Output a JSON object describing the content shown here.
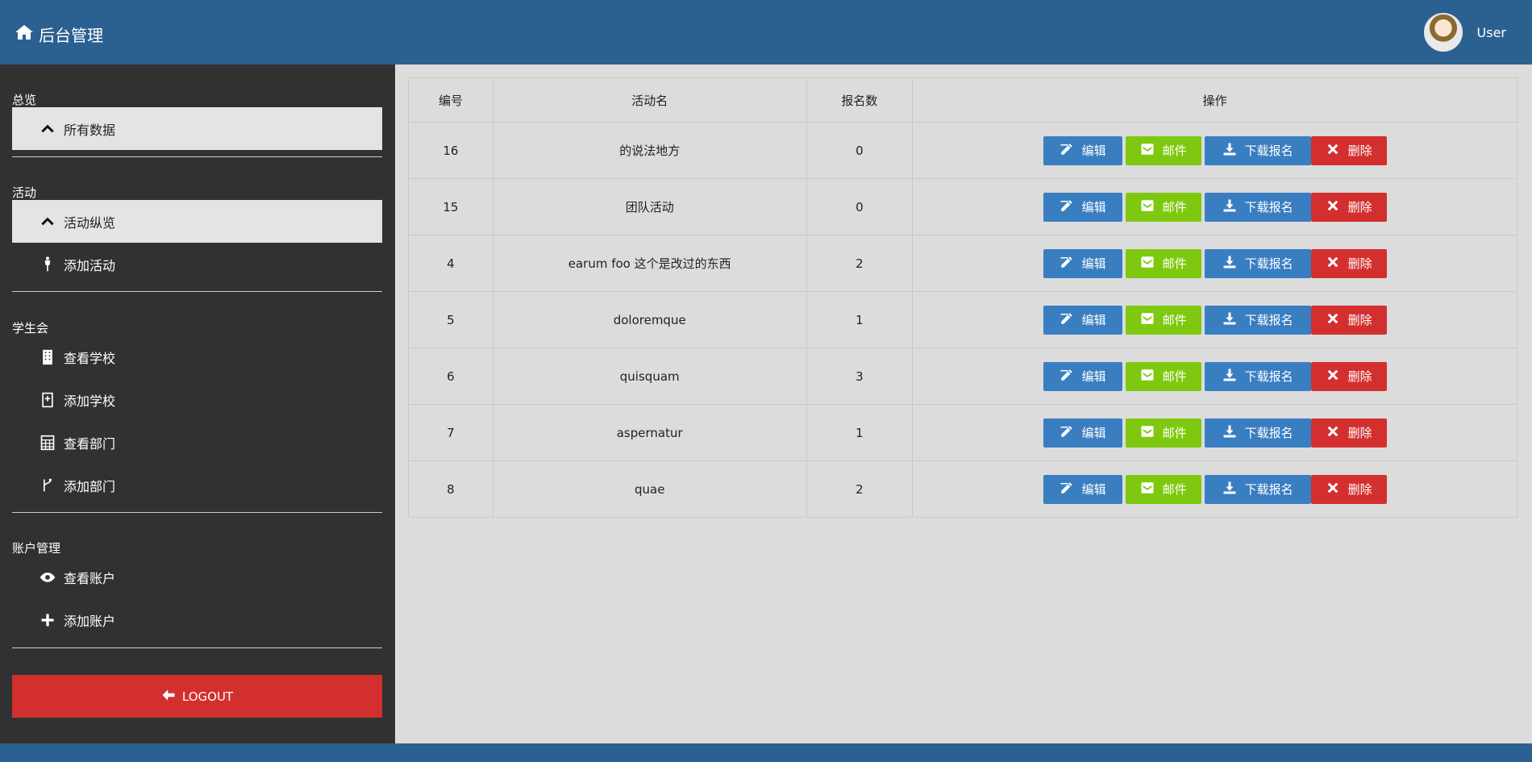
{
  "header": {
    "title": "后台管理",
    "user": "User"
  },
  "sidebar": {
    "sections": [
      {
        "title": "总览",
        "items": [
          {
            "label": "所有数据",
            "icon": "chevron-up-icon",
            "active": true
          }
        ]
      },
      {
        "title": "活动",
        "items": [
          {
            "label": "活动纵览",
            "icon": "chevron-up-icon",
            "active": true
          },
          {
            "label": "添加活动",
            "icon": "person-icon",
            "active": false
          }
        ]
      },
      {
        "title": "学生会",
        "items": [
          {
            "label": "查看学校",
            "icon": "building-icon",
            "active": false
          },
          {
            "label": "添加学校",
            "icon": "building-plus-icon",
            "active": false
          },
          {
            "label": "查看部门",
            "icon": "calculator-icon",
            "active": false
          },
          {
            "label": "添加部门",
            "icon": "branch-icon",
            "active": false
          }
        ]
      },
      {
        "title": "账户管理",
        "items": [
          {
            "label": "查看账户",
            "icon": "eye-icon",
            "active": false
          },
          {
            "label": "添加账户",
            "icon": "plus-icon",
            "active": false
          }
        ]
      }
    ],
    "logout_label": "LOGOUT"
  },
  "table": {
    "headers": [
      "编号",
      "活动名",
      "报名数",
      "操作"
    ],
    "rows": [
      {
        "id": "16",
        "name": "的说法地方",
        "count": "0"
      },
      {
        "id": "15",
        "name": "团队活动",
        "count": "0"
      },
      {
        "id": "4",
        "name": "earum foo 这个是改过的东西",
        "count": "2"
      },
      {
        "id": "5",
        "name": "doloremque",
        "count": "1"
      },
      {
        "id": "6",
        "name": "quisquam",
        "count": "3"
      },
      {
        "id": "7",
        "name": "aspernatur",
        "count": "1"
      },
      {
        "id": "8",
        "name": "quae",
        "count": "2"
      }
    ],
    "actions": {
      "edit": "编辑",
      "mail": "邮件",
      "download": "下载报名",
      "delete": "删除"
    }
  },
  "colors": {
    "header": "#2b6190",
    "sidebar": "#313131",
    "edit": "#3a7ec2",
    "mail": "#7ec90f",
    "delete": "#d32f2f"
  }
}
